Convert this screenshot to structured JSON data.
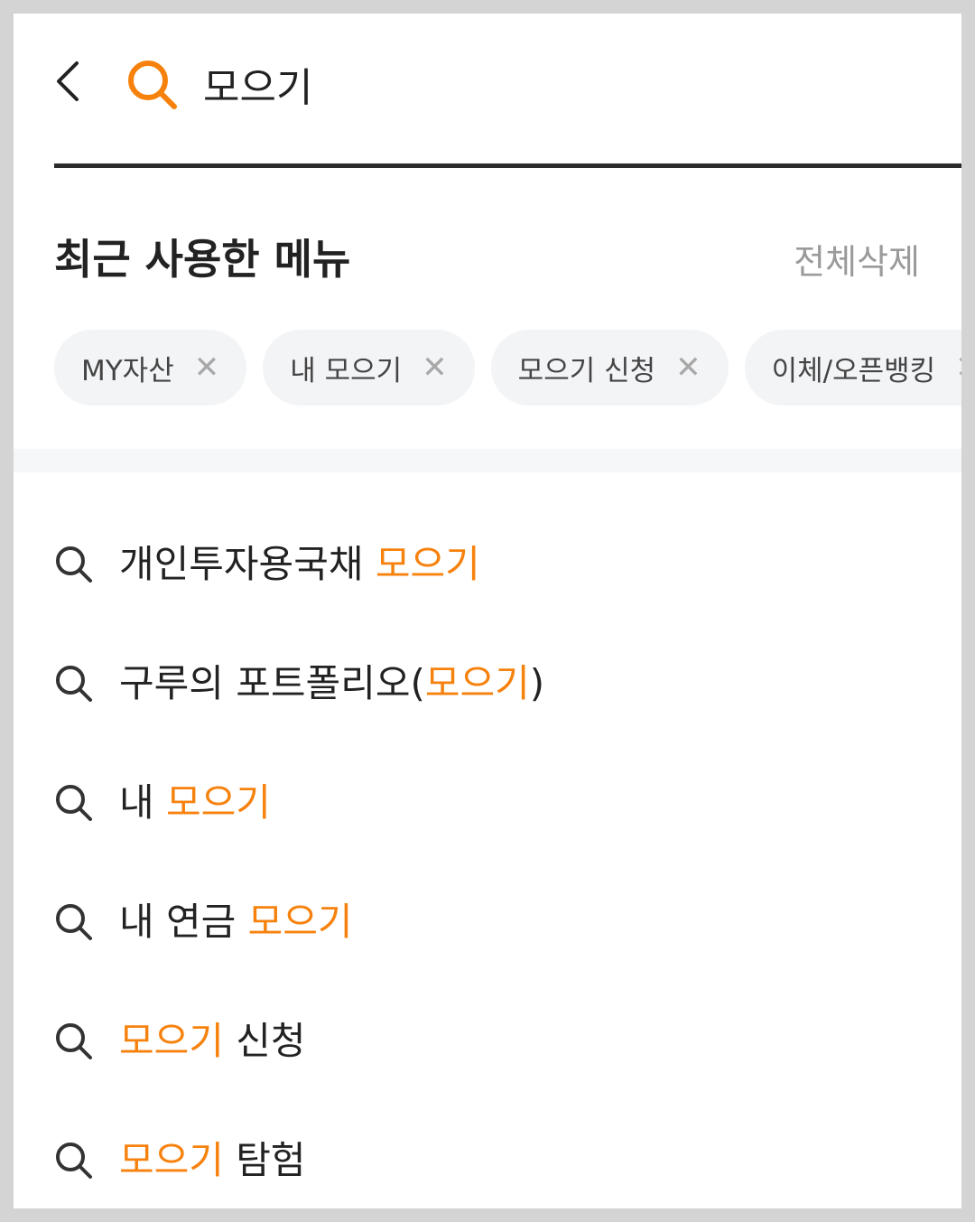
{
  "search": {
    "query": "모으기"
  },
  "recent": {
    "title": "최근 사용한 메뉴",
    "clear_all": "전체삭제",
    "chips": [
      "MY자산",
      "내 모으기",
      "모으기 신청",
      "이체/오픈뱅킹"
    ]
  },
  "results": [
    {
      "before": "개인투자용국채 ",
      "highlight": "모으기",
      "after": ""
    },
    {
      "before": "구루의 포트폴리오(",
      "highlight": "모으기",
      "after": ")"
    },
    {
      "before": "내 ",
      "highlight": "모으기",
      "after": ""
    },
    {
      "before": "내 연금 ",
      "highlight": "모으기",
      "after": ""
    },
    {
      "before": "",
      "highlight": "모으기",
      "after": " 신청"
    },
    {
      "before": "",
      "highlight": "모으기",
      "after": " 탐험"
    }
  ],
  "icons": {
    "back": "chevron-left-icon",
    "search": "search-icon",
    "chip_remove": "close-icon",
    "result": "search-icon"
  },
  "colors": {
    "accent": "#f6820d",
    "text": "#222222",
    "muted": "#9a9a9a",
    "chip_bg": "#f3f4f6"
  }
}
